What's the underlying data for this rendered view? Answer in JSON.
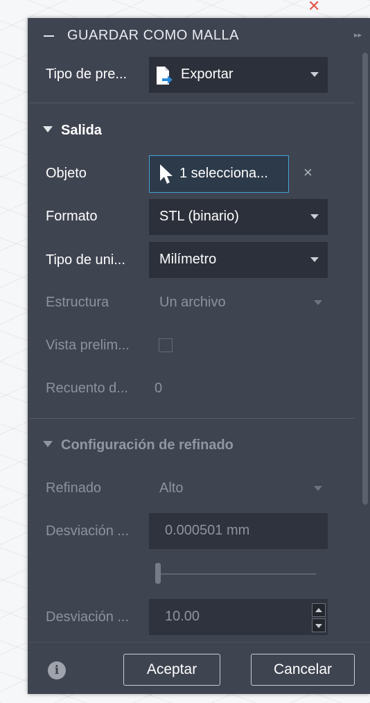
{
  "dialog": {
    "title": "GUARDAR COMO MALLA"
  },
  "tipo_proceso": {
    "label": "Tipo de pre...",
    "value": "Exportar"
  },
  "salida": {
    "heading": "Salida",
    "objeto": {
      "label": "Objeto",
      "value": "1 selecciona...",
      "clear": "×"
    },
    "formato": {
      "label": "Formato",
      "value": "STL (binario)"
    },
    "tipo_unidad": {
      "label": "Tipo de uni...",
      "value": "Milímetro"
    },
    "estructura": {
      "label": "Estructura",
      "value": "Un archivo"
    },
    "vista_previa": {
      "label": "Vista prelim...",
      "checked": false
    },
    "recuento": {
      "label": "Recuento d...",
      "value": "0"
    }
  },
  "refinado": {
    "heading": "Configuración de refinado",
    "refinado": {
      "label": "Refinado",
      "value": "Alto"
    },
    "desviacion_superficie": {
      "label": "Desviación ...",
      "value": "0.000501 mm"
    },
    "slider_level": 0.0,
    "desviacion_normal": {
      "label": "Desviación ...",
      "value": "10.00"
    }
  },
  "footer": {
    "info": "i",
    "accept": "Aceptar",
    "cancel": "Cancelar"
  }
}
